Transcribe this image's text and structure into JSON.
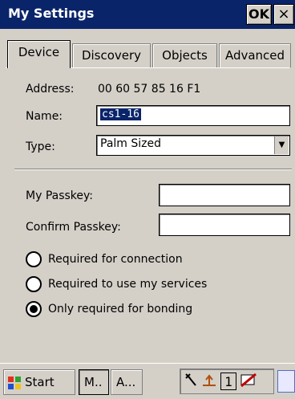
{
  "window": {
    "title": "My Settings",
    "ok_label": "OK",
    "close_label": "×"
  },
  "tabs": [
    {
      "label": "Device"
    },
    {
      "label": "Discovery"
    },
    {
      "label": "Objects"
    },
    {
      "label": "Advanced"
    }
  ],
  "device": {
    "address_label": "Address:",
    "address_value": "00 60 57 85 16 F1",
    "name_label": "Name:",
    "name_value": "cs1-16",
    "type_label": "Type:",
    "type_value": "Palm Sized"
  },
  "passkey": {
    "my_label": "My Passkey:",
    "my_value": "",
    "confirm_label": "Confirm Passkey:",
    "confirm_value": ""
  },
  "radio_options": [
    {
      "label": "Required for connection",
      "checked": false
    },
    {
      "label": "Required to use my services",
      "checked": false
    },
    {
      "label": "Only required for bonding",
      "checked": true
    }
  ],
  "taskbar": {
    "start_label": "Start",
    "task1_label": "M..",
    "task2_label": "A...",
    "tray_number": "1"
  },
  "colors": {
    "titlebar": "#0a246a",
    "selection": "#0a246a",
    "face": "#d4d0c8"
  }
}
